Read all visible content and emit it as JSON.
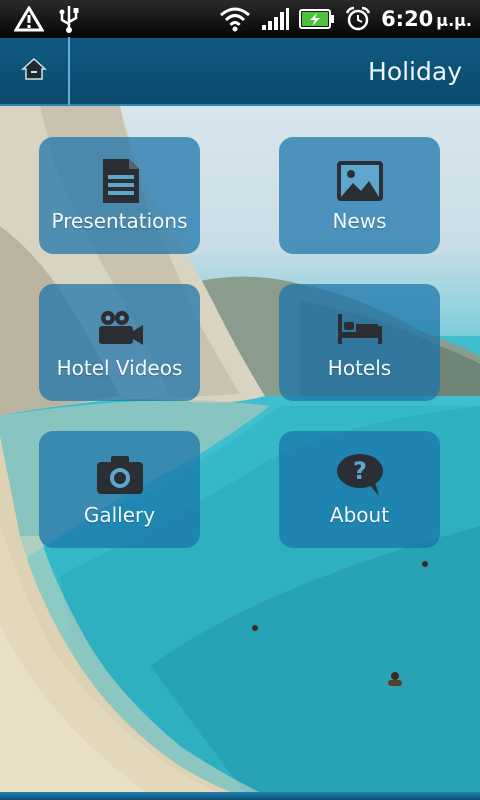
{
  "status_bar": {
    "time": "6:20",
    "ampm": "μ.μ.",
    "icons": [
      "warning-icon",
      "usb-icon",
      "wifi-icon",
      "signal-icon",
      "battery-charging-icon",
      "alarm-icon"
    ]
  },
  "action_bar": {
    "title": "Holiday",
    "home_icon": "home-icon"
  },
  "menu": {
    "items": [
      {
        "label": "Presentations",
        "icon": "document-icon"
      },
      {
        "label": "News",
        "icon": "picture-icon"
      },
      {
        "label": "Hotel Videos",
        "icon": "video-camera-icon"
      },
      {
        "label": "Hotels",
        "icon": "bed-icon"
      },
      {
        "label": "Gallery",
        "icon": "camera-icon"
      },
      {
        "label": "About",
        "icon": "question-bubble-icon"
      }
    ]
  },
  "colors": {
    "action_bar": "#0f5a82",
    "tile": "#1973aa",
    "icon": "#2b2f33"
  }
}
